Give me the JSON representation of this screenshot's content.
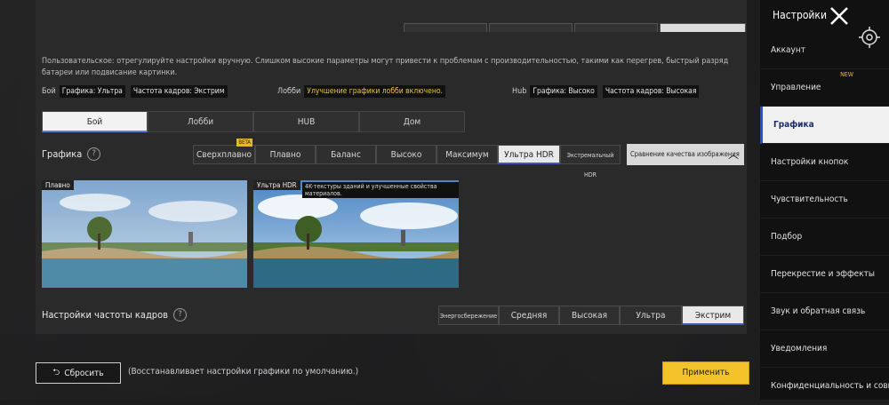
{
  "description": "Пользовательское: отрегулируйте настройки вручную. Слишком высокие параметры могут привести к проблемам с производительностью, такими как перегрев, быстрый разряд батареи или подвисание картинки.",
  "summary": {
    "battle_label": "Бой",
    "battle_graphics": "Графика: Ультра",
    "battle_fps": "Частота кадров: Экстрим",
    "lobby_label": "Лобби",
    "lobby_value": "Улучшение графики лобби включено.",
    "hub_label": "Hub",
    "hub_graphics": "Графика: Высоко",
    "hub_fps": "Частота кадров: Высокая"
  },
  "tabs": [
    {
      "label": "Бой",
      "active": true
    },
    {
      "label": "Лобби"
    },
    {
      "label": "HUB"
    },
    {
      "label": "Дом"
    }
  ],
  "graphics": {
    "label": "Графика",
    "beta": "BETA",
    "options": [
      "Сверхплавно",
      "Плавно",
      "Баланс",
      "Высоко",
      "Максимум",
      "Ультра HDR",
      "Экстремальный HDR"
    ],
    "selected": "Ультра HDR",
    "compare": "Сравнение качества изображения"
  },
  "preview": {
    "left_tag": "Плавно",
    "right_tag": "Ультра HDR",
    "right_note": "4K-текстуры зданий и улучшенные свойства материалов."
  },
  "fps": {
    "label": "Настройки частоты кадров",
    "options": [
      "Энергосбережение",
      "Средняя",
      "Высокая",
      "Ультра",
      "Экстрим"
    ],
    "selected": "Экстрим"
  },
  "bottom": {
    "reset": "Сбросить",
    "reset_note": "(Восстанавливает настройки графики по умолчанию.)",
    "apply": "Применить"
  },
  "sidebar": {
    "title": "Настройки",
    "new_badge": "NEW",
    "items": [
      {
        "label": "Аккаунт"
      },
      {
        "label": "Управление"
      },
      {
        "label": "Графика",
        "active": true
      },
      {
        "label": "Настройки кнопок"
      },
      {
        "label": "Чувствительность"
      },
      {
        "label": "Подбор"
      },
      {
        "label": "Перекрестие и эффекты"
      },
      {
        "label": "Звук и обратная связь"
      },
      {
        "label": "Уведомления"
      },
      {
        "label": "Конфиденциальность и совместимость"
      }
    ]
  },
  "colors": {
    "accent_yellow": "#f4c22a",
    "active_blue": "#2c4bd8"
  }
}
